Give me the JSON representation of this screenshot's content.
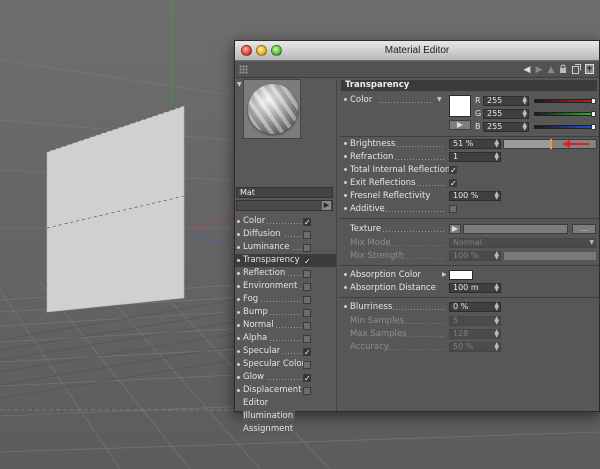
{
  "window": {
    "title": "Material Editor"
  },
  "toolbar": {
    "icons": [
      "grip-icon",
      "back-arrow-icon",
      "forward-arrow-icon",
      "up-arrow-icon",
      "lock-icon",
      "new-window-icon",
      "pin-icon"
    ]
  },
  "preview": {
    "material_name": "Mat"
  },
  "channels": [
    {
      "label": "Color",
      "checkbox": true,
      "checked": true,
      "selected": false
    },
    {
      "label": "Diffusion",
      "checkbox": true,
      "checked": false,
      "selected": false
    },
    {
      "label": "Luminance",
      "checkbox": true,
      "checked": false,
      "selected": false
    },
    {
      "label": "Transparency",
      "checkbox": true,
      "checked": true,
      "selected": true
    },
    {
      "label": "Reflection",
      "checkbox": true,
      "checked": false,
      "selected": false
    },
    {
      "label": "Environment",
      "checkbox": true,
      "checked": false,
      "selected": false
    },
    {
      "label": "Fog",
      "checkbox": true,
      "checked": false,
      "selected": false
    },
    {
      "label": "Bump",
      "checkbox": true,
      "checked": false,
      "selected": false
    },
    {
      "label": "Normal",
      "checkbox": true,
      "checked": false,
      "selected": false
    },
    {
      "label": "Alpha",
      "checkbox": true,
      "checked": false,
      "selected": false
    },
    {
      "label": "Specular",
      "checkbox": true,
      "checked": true,
      "selected": false
    },
    {
      "label": "Specular Color",
      "checkbox": true,
      "checked": false,
      "selected": false
    },
    {
      "label": "Glow",
      "checkbox": true,
      "checked": true,
      "selected": false
    },
    {
      "label": "Displacement",
      "checkbox": true,
      "checked": false,
      "selected": false
    },
    {
      "label": "Editor",
      "checkbox": false,
      "checked": false,
      "selected": false
    },
    {
      "label": "Illumination",
      "checkbox": false,
      "checked": false,
      "selected": false
    },
    {
      "label": "Assignment",
      "checkbox": false,
      "checked": false,
      "selected": false
    }
  ],
  "panel": {
    "section_title": "Transparency",
    "color": {
      "label": "Color",
      "swatch": "#ffffff",
      "r_label": "R",
      "g_label": "G",
      "b_label": "B",
      "r": "255",
      "g": "255",
      "b": "255"
    },
    "brightness": {
      "label": "Brightness",
      "value": "51 %",
      "fraction": 0.51,
      "marker_color": "#e8a21a",
      "arrow_color": "#e02020"
    },
    "refraction": {
      "label": "Refraction",
      "value": "1"
    },
    "total_internal_reflection": {
      "label": "Total Internal Reflection",
      "checked": true
    },
    "exit_reflections": {
      "label": "Exit Reflections",
      "checked": true
    },
    "fresnel_reflectivity": {
      "label": "Fresnel Reflectivity",
      "value": "100 %"
    },
    "additive": {
      "label": "Additive",
      "checked": false
    },
    "texture": {
      "label": "Texture",
      "more_button": "..."
    },
    "mix_mode": {
      "label": "Mix Mode",
      "value": "Normal"
    },
    "mix_strength": {
      "label": "Mix Strength",
      "value": "100 %"
    },
    "absorption_color": {
      "label": "Absorption Color",
      "swatch": "#ffffff"
    },
    "absorption_distance": {
      "label": "Absorption Distance",
      "value": "100 m"
    },
    "blurriness": {
      "label": "Blurriness",
      "value": "0 %"
    },
    "min_samples": {
      "label": "Min Samples",
      "value": "5"
    },
    "max_samples": {
      "label": "Max Samples",
      "value": "128"
    },
    "accuracy": {
      "label": "Accuracy",
      "value": "50 %"
    }
  }
}
